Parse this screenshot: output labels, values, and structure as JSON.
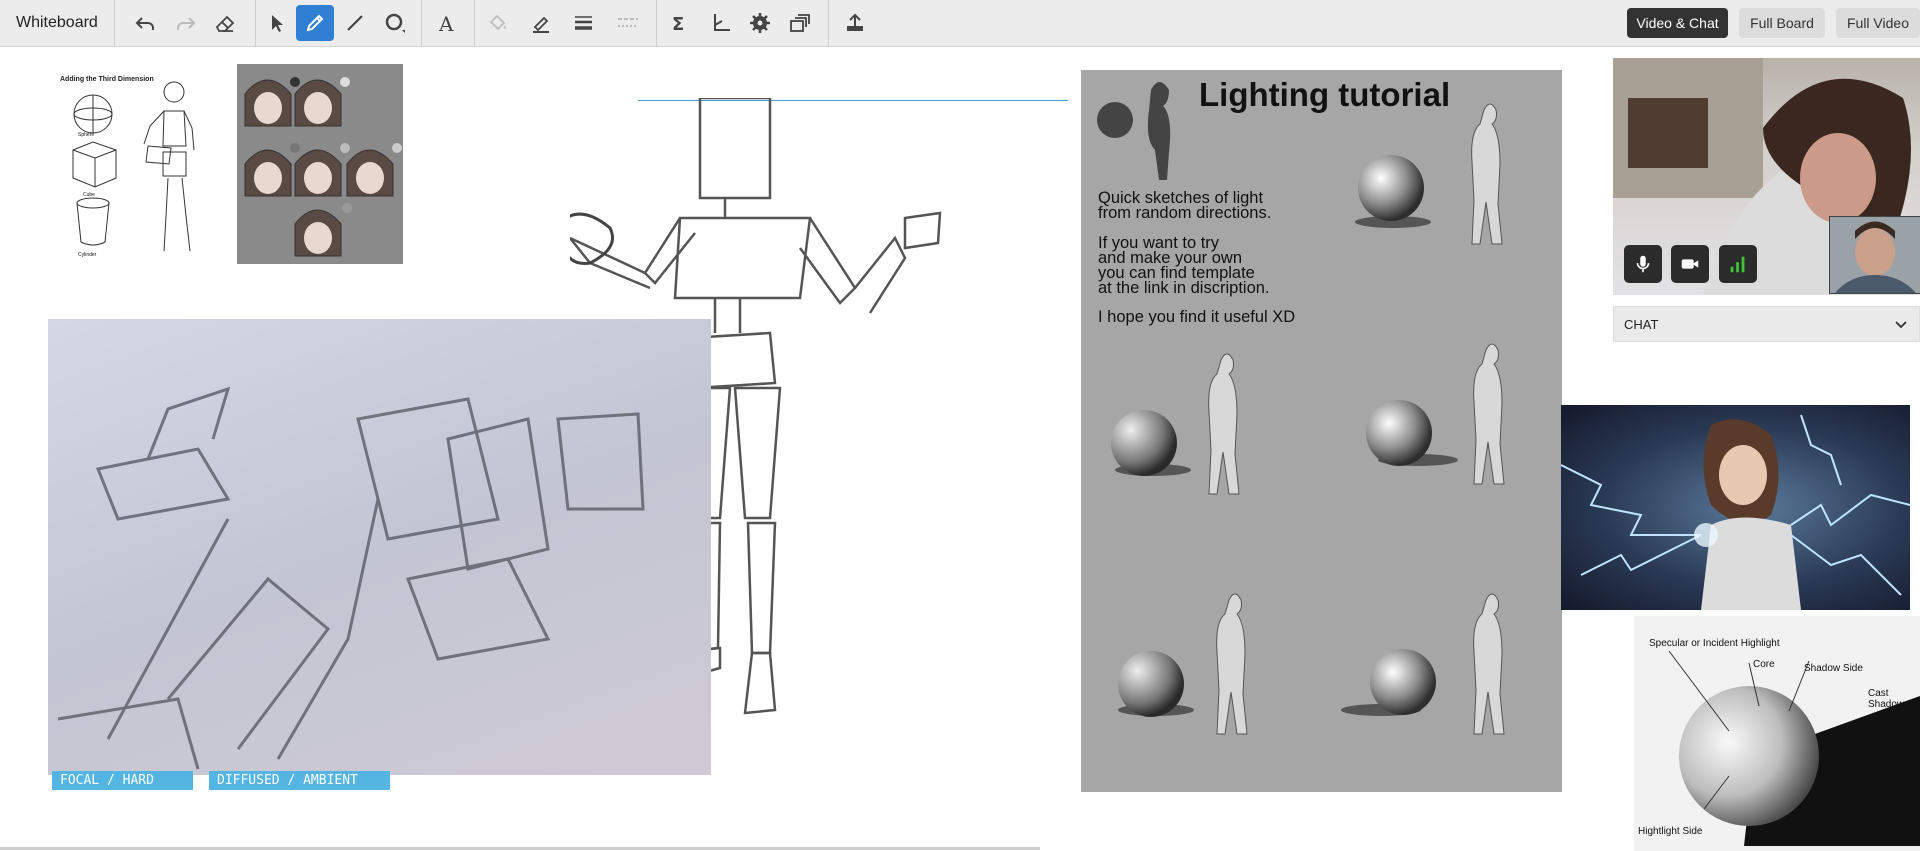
{
  "app": {
    "title": "Whiteboard"
  },
  "toolbar": {
    "tools": [
      "undo",
      "redo",
      "eraser",
      "select",
      "pencil",
      "line",
      "shape",
      "text",
      "fill",
      "highlighter",
      "line-style",
      "dash-style",
      "equation",
      "graph",
      "settings",
      "image-scan",
      "export"
    ],
    "active_tool": "pencil"
  },
  "view_buttons": {
    "video_chat": "Video & Chat",
    "full_board": "Full Board",
    "full_video": "Full Video"
  },
  "chat": {
    "label": "CHAT"
  },
  "canvas": {
    "three_d_sheet": {
      "title": "Adding the Third Dimension",
      "labels": [
        "Sphere",
        "Cube",
        "Cylinder"
      ]
    },
    "lighting_tutorial": {
      "title": "Lighting tutorial",
      "para1": "Quick sketches of light\nfrom random directions.",
      "para2": "If you want to try\nand make your own\nyou can find template\nat the link in discription.",
      "para3": "I hope you find it useful XD"
    },
    "sphere_diagram": {
      "labels": [
        "Specular or Incident Highlight",
        "Core",
        "Shadow Side",
        "Cast Shadow",
        "Hightlight Side"
      ]
    },
    "light_tags": [
      "FOCAL / HARD LIGHT",
      "DIFFUSED / AMBIENT LIGHT"
    ]
  },
  "colors": {
    "accent": "#2f7fd3",
    "toolbar_bg": "#ececec",
    "tag_blue": "#54b5e2",
    "tutorial_bg": "#a6a6a6",
    "signal_green": "#3fc33a"
  }
}
